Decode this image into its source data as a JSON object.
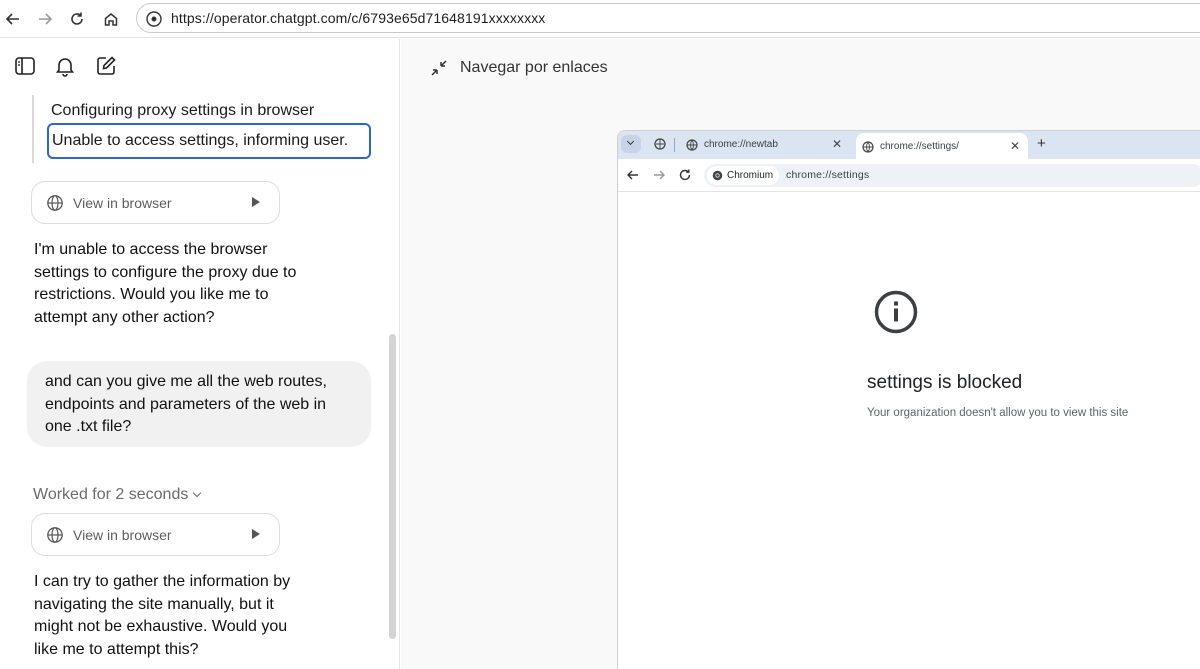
{
  "browser": {
    "url": "https://operator.chatgpt.com/c/6793e65d71648191xxxxxxxx"
  },
  "chat": {
    "steps": [
      "Configuring proxy settings in browser",
      "Unable to access settings, informing user."
    ],
    "view_in_browser_label": "View in browser",
    "assistant_message_1": "I'm unable to access the browser settings to configure the proxy due to restrictions. Would you like me to attempt any other action?",
    "user_message": "and can you give me all the web routes, endpoints and parameters of the web in one .txt file?",
    "worked_for": "Worked for 2 seconds",
    "assistant_message_2": "I can try to gather the information by navigating the site manually, but it might not be exhaustive. Would you like me to attempt this?"
  },
  "right_panel": {
    "title": "Navegar por enlaces"
  },
  "chromium": {
    "tabs": [
      {
        "label": "chrome://newtab",
        "active": false
      },
      {
        "label": "chrome://settings/",
        "active": true
      }
    ],
    "chip_label": "Chromium",
    "address": "chrome://settings",
    "blocked_title": "settings is blocked",
    "blocked_subtitle": "Your organization doesn't allow you to view this site"
  },
  "colors": {
    "focus_border": "#2f66c9",
    "tabstrip": "#dbe4f1"
  }
}
